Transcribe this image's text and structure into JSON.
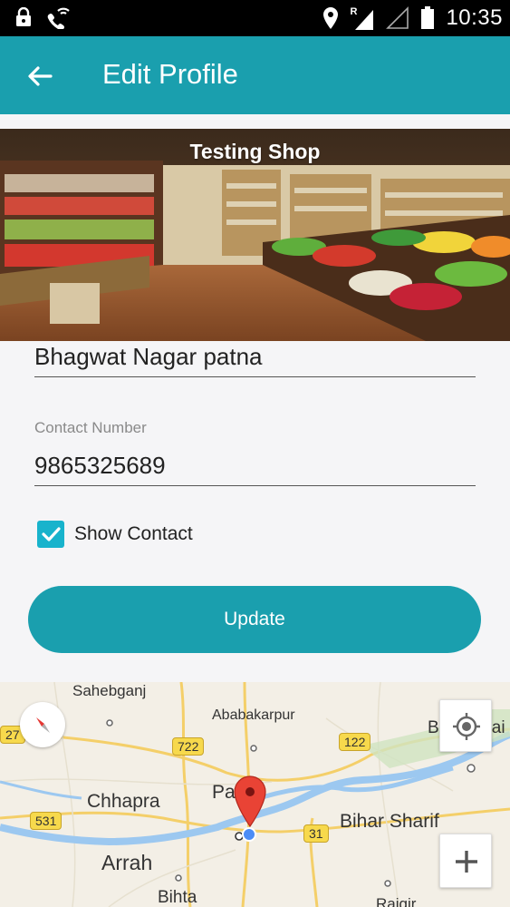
{
  "status_bar": {
    "time": "10:35",
    "network_label": "R",
    "icons": [
      "lock-icon",
      "wifi-call-icon",
      "location-icon",
      "signal-icon",
      "no-signal-icon",
      "battery-icon"
    ]
  },
  "app_bar": {
    "title": "Edit Profile",
    "back_icon": "arrow-back-icon",
    "color": "#1a9fae"
  },
  "shop": {
    "banner_title": "Testing Shop"
  },
  "form": {
    "address_value": "Bhagwat Nagar patna",
    "contact_label": "Contact Number",
    "contact_value": "9865325689",
    "show_contact_label": "Show Contact",
    "show_contact_checked": true,
    "update_label": "Update"
  },
  "map": {
    "places": {
      "sahebganj": "Sahebganj",
      "ababakarpur": "Ababakarpur",
      "begusarai": "Begusarai",
      "chhapra": "Chhapra",
      "patna": "Pa",
      "bihar_sharif": "Bihar Sharif",
      "arrah": "Arrah",
      "bihta": "Bihta",
      "bajgir": "Rajgir"
    },
    "roads": {
      "r27": "27",
      "r722": "722",
      "r122": "122",
      "r531": "531",
      "r31": "31"
    },
    "controls": {
      "locate": "my-location-icon",
      "zoom_in": "+",
      "compass": "compass-icon"
    }
  }
}
